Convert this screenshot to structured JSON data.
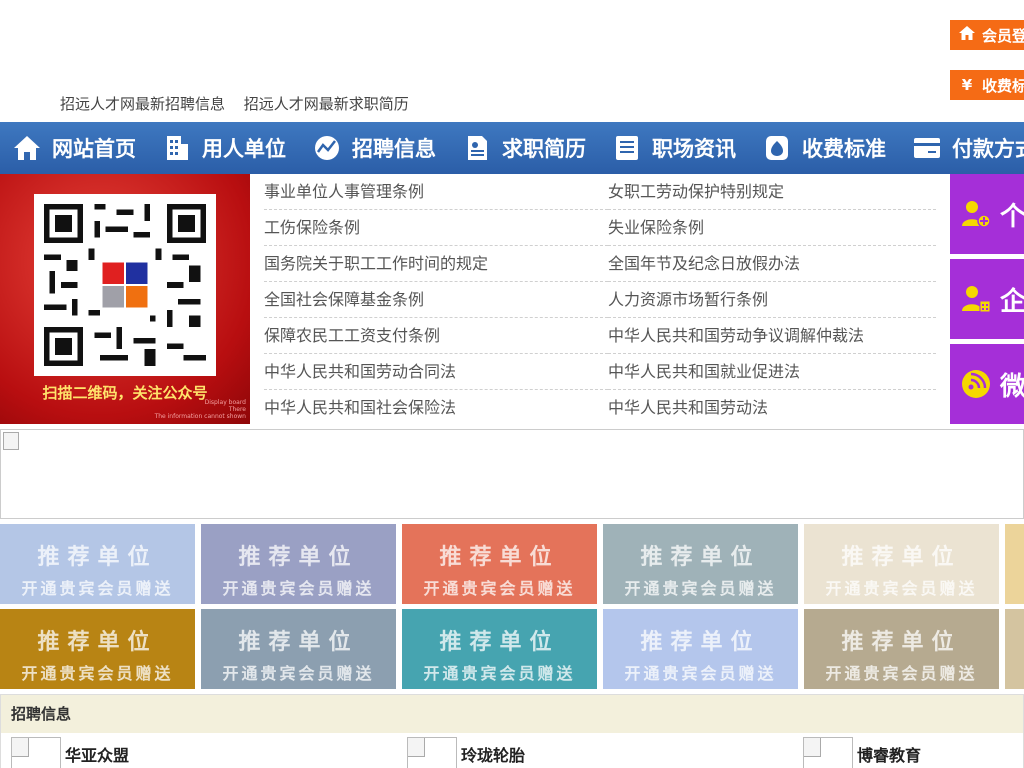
{
  "header": {
    "links": [
      "招远人才网最新招聘信息",
      "招远人才网最新求职简历"
    ],
    "login_button": "会员登",
    "fee_button": "收费标",
    "fee_icon": "¥"
  },
  "nav": {
    "items": [
      {
        "label": "网站首页",
        "icon": "home-icon"
      },
      {
        "label": "用人单位",
        "icon": "building-icon"
      },
      {
        "label": "招聘信息",
        "icon": "chart-icon"
      },
      {
        "label": "求职简历",
        "icon": "resume-icon"
      },
      {
        "label": "职场资讯",
        "icon": "news-icon"
      },
      {
        "label": "收费标准",
        "icon": "money-bag-icon"
      },
      {
        "label": "付款方式",
        "icon": "card-icon"
      }
    ]
  },
  "qr": {
    "caption": "扫描二维码，关注公众号",
    "small_text": [
      "Display board",
      "There",
      "The information cannot shown"
    ]
  },
  "laws": [
    [
      "事业单位人事管理条例",
      "女职工劳动保护特别规定"
    ],
    [
      "工伤保险条例",
      "失业保险条例"
    ],
    [
      "国务院关于职工工作时间的规定",
      "全国年节及纪念日放假办法"
    ],
    [
      "全国社会保障基金条例",
      "人力资源市场暂行条例"
    ],
    [
      "保障农民工工资支付条例",
      "中华人民共和国劳动争议调解仲裁法"
    ],
    [
      "中华人民共和国劳动合同法",
      "中华人民共和国就业促进法"
    ],
    [
      "中华人民共和国社会保险法",
      "中华人民共和国劳动法"
    ]
  ],
  "side_tiles": [
    {
      "label": "个",
      "icon": "user-add-icon"
    },
    {
      "label": "企",
      "icon": "company-user-icon"
    },
    {
      "label": "微",
      "icon": "wechat-icon"
    }
  ],
  "tiles": {
    "line1": "推荐单位",
    "line2": "开通贵宾会员赠送",
    "colors": [
      [
        "#b4c6e6",
        "#9aa0c4",
        "#e4735a",
        "#9fb2b8",
        "#ebe3d2",
        "#ecd49a"
      ],
      [
        "#b88414",
        "#8c9fb0",
        "#46a4b0",
        "#b4c6ec",
        "#b6aa90",
        "#d4c4a0"
      ]
    ]
  },
  "recruit": {
    "title": "招聘信息",
    "companies": [
      "华亚众盟",
      "玲珑轮胎",
      "博睿教育"
    ]
  },
  "colors": {
    "nav_bg": "#2f65ae",
    "orange": "#f56b15",
    "purple": "#a52fd8",
    "qr_red": "#c8181a"
  }
}
